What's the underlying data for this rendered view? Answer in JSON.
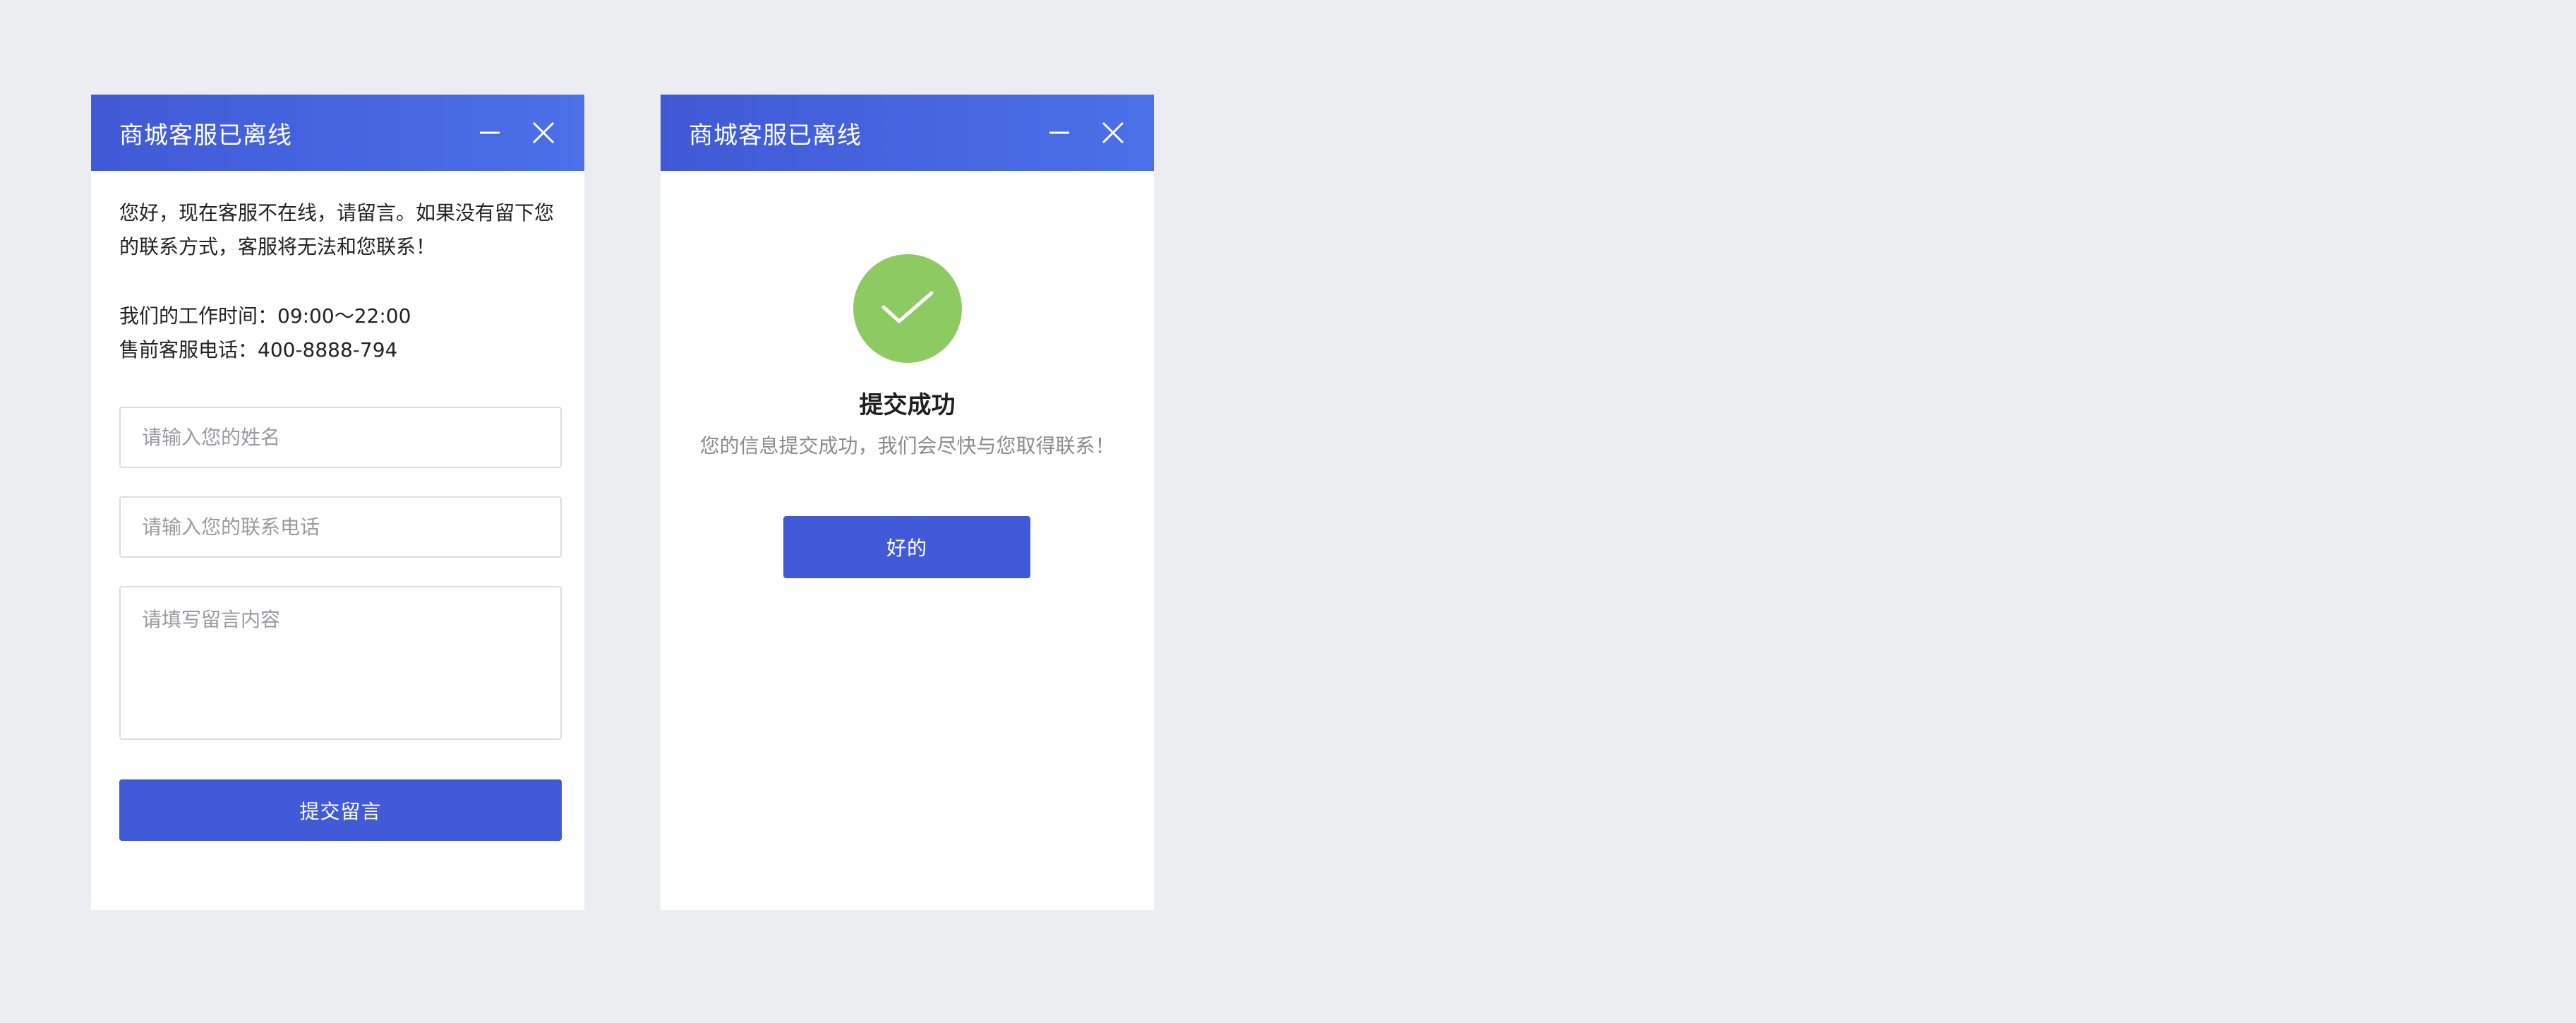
{
  "colors": {
    "page_background": "#ecedf1",
    "titlebar_gradient_start": "#4159d6",
    "titlebar_gradient_end": "#4b70e8",
    "primary_button": "#415ad7",
    "success_green": "#8dcb62"
  },
  "offline_form": {
    "title": "商城客服已离线",
    "minimize_icon": "minus-icon",
    "close_icon": "close-icon",
    "intro": "您好，现在客服不在线，请留言。如果没有留下您的联系方式，客服将无法和您联系！",
    "work_hours": "我们的工作时间：09:00～22:00",
    "presale_phone": "售前客服电话：400-8888-794",
    "name_placeholder": "请输入您的姓名",
    "phone_placeholder": "请输入您的联系电话",
    "message_placeholder": "请填写留言内容",
    "submit_label": "提交留言"
  },
  "success_dialog": {
    "title": "商城客服已离线",
    "minimize_icon": "minus-icon",
    "close_icon": "close-icon",
    "status_icon": "checkmark-icon",
    "heading": "提交成功",
    "message": "您的信息提交成功，我们会尽快与您取得联系！",
    "ok_label": "好的"
  }
}
